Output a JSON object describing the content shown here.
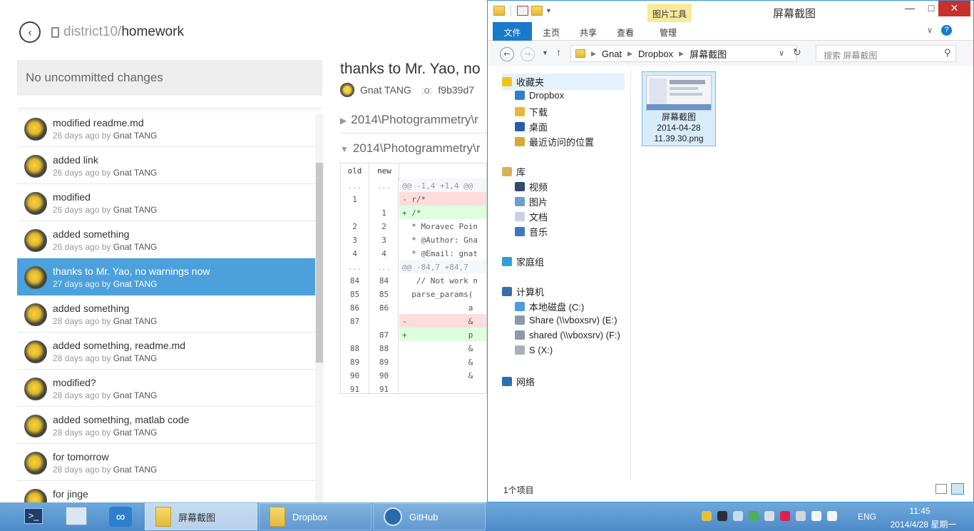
{
  "github": {
    "back_icon": "back-arrow-icon",
    "repo_owner": "district10/",
    "repo_name": "homework",
    "uncommitted": "No uncommitted changes",
    "commits": [
      {
        "title": "modified readme.md",
        "age": "26 days ago by",
        "author": "Gnat TANG",
        "selected": false
      },
      {
        "title": "added link",
        "age": "26 days ago by",
        "author": "Gnat TANG",
        "selected": false
      },
      {
        "title": "modified",
        "age": "26 days ago by",
        "author": "Gnat TANG",
        "selected": false
      },
      {
        "title": "added something",
        "age": "26 days ago by",
        "author": "Gnat TANG",
        "selected": false
      },
      {
        "title": "thanks to Mr. Yao, no warnings now",
        "age": "27 days ago by",
        "author": "Gnat TANG",
        "selected": true
      },
      {
        "title": "added something",
        "age": "28 days ago by",
        "author": "Gnat TANG",
        "selected": false
      },
      {
        "title": "added something, readme.md",
        "age": "28 days ago by",
        "author": "Gnat TANG",
        "selected": false
      },
      {
        "title": "modified?",
        "age": "28 days ago by",
        "author": "Gnat TANG",
        "selected": false
      },
      {
        "title": "added something, matlab code",
        "age": "28 days ago by",
        "author": "Gnat TANG",
        "selected": false
      },
      {
        "title": "for tomorrow",
        "age": "28 days ago by",
        "author": "Gnat TANG",
        "selected": false
      },
      {
        "title": "for jinge",
        "age": "",
        "author": "",
        "selected": false
      }
    ],
    "detail": {
      "title": "thanks to Mr. Yao, no",
      "author": "Gnat TANG",
      "sha": "f9b39d7",
      "files": [
        "2014\\Photogrammetry\\r",
        "2014\\Photogrammetry\\r"
      ],
      "diff_headers": [
        "old",
        "new"
      ],
      "diff_rows": [
        {
          "type": "hunk",
          "old": "...",
          "new": "...",
          "code": "@@ -1,4 +1,4 @@"
        },
        {
          "type": "del",
          "old": "1",
          "new": "",
          "code": "- r/*"
        },
        {
          "type": "add",
          "old": "",
          "new": "1",
          "code": "+ /*"
        },
        {
          "type": "ctx",
          "old": "2",
          "new": "2",
          "code": "  * Moravec Poin"
        },
        {
          "type": "ctx",
          "old": "3",
          "new": "3",
          "code": "  * @Author: Gna"
        },
        {
          "type": "ctx",
          "old": "4",
          "new": "4",
          "code": "  * @Email: gnat"
        },
        {
          "type": "hunk",
          "old": "...",
          "new": "...",
          "code": "@@ -84,7 +84,7"
        },
        {
          "type": "ctx",
          "old": "84",
          "new": "84",
          "code": "   // Not work n"
        },
        {
          "type": "ctx",
          "old": "85",
          "new": "85",
          "code": "  parse_params("
        },
        {
          "type": "ctx",
          "old": "86",
          "new": "86",
          "code": "              a"
        },
        {
          "type": "del",
          "old": "87",
          "new": "",
          "code": "-             &"
        },
        {
          "type": "add",
          "old": "",
          "new": "87",
          "code": "+             p"
        },
        {
          "type": "ctx",
          "old": "88",
          "new": "88",
          "code": "              &"
        },
        {
          "type": "ctx",
          "old": "89",
          "new": "89",
          "code": "              &"
        },
        {
          "type": "ctx",
          "old": "90",
          "new": "90",
          "code": "              &"
        },
        {
          "type": "ctx",
          "old": "91",
          "new": "91",
          "code": ""
        }
      ]
    }
  },
  "explorer": {
    "window_title": "屏幕截图",
    "tools_tab": "图片工具",
    "ribbon_tabs": [
      "文件",
      "主页",
      "共享",
      "查看",
      "管理"
    ],
    "breadcrumb": [
      "Gnat",
      "Dropbox",
      "屏幕截图"
    ],
    "search_placeholder": "搜索 屏幕截图",
    "nav": {
      "favorites": "收藏夹",
      "fav_items": [
        "Dropbox",
        "下载",
        "桌面",
        "最近访问的位置"
      ],
      "libraries": "库",
      "lib_items": [
        "视频",
        "图片",
        "文档",
        "音乐"
      ],
      "homegroup": "家庭组",
      "computer": "计算机",
      "drives": [
        "本地磁盘 (C:)",
        "Share (\\\\vboxsrv) (E:)",
        "shared (\\\\vboxsrv) (F:)",
        "S (X:)"
      ],
      "network": "网络"
    },
    "file": {
      "line1": "屏幕截图",
      "line2": "2014-04-28",
      "line3": "11.39.30.png"
    },
    "status": "1个项目"
  },
  "taskbar": {
    "buttons": [
      "屏幕截图",
      "Dropbox",
      "GitHub"
    ],
    "lang": "ENG",
    "time": "11:45",
    "date": "2014/4/28 星期一"
  },
  "colors": {
    "selected": "#4ca1dd",
    "taskbar": "#5b97d0",
    "file_tab": "#1979ca",
    "close": "#c7302b"
  }
}
